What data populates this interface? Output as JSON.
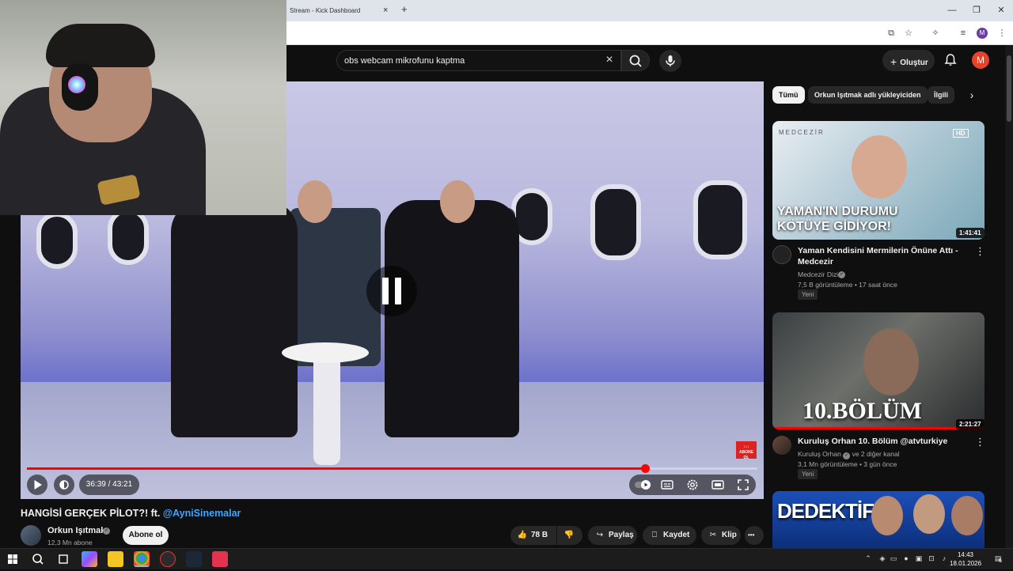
{
  "browser": {
    "tab_title": "Stream - Kick Dashboard",
    "tab_close": "×",
    "new_tab": "+",
    "minimize": "—",
    "restore": "❐",
    "close": "✕",
    "profile_letter": "M"
  },
  "header": {
    "search_value": "obs webcam mikrofunu kaptma",
    "clear_glyph": "×",
    "create_label": "Oluştur",
    "create_plus": "+",
    "avatar_letter": "M"
  },
  "player": {
    "time_display": "36:39 / 43:21",
    "progress_fraction": 0.846,
    "subscribe_overlay": "↓↓↓ ABONE OL"
  },
  "video": {
    "title_main": "HANGİSİ GERÇEK PİLOT?! ft. ",
    "title_mention": "@AyniSinemalar",
    "channel_name": "Orkun Işıtmak",
    "subscribers": "12,3 Mn abone",
    "subscribe_label": "Abone ol",
    "likes": "78 B",
    "share_label": "Paylaş",
    "save_label": "Kaydet",
    "clip_label": "Klip",
    "more_glyph": "•••"
  },
  "sidebar": {
    "chips": [
      "Tümü",
      "Orkun Işıtmak adlı yükleyiciden",
      "İlgili"
    ],
    "chip_next": "›",
    "videos": [
      {
        "title": "Yaman Kendisini Mermilerin Önüne Attı - Medcezir",
        "channel": "Medcezir Dizi",
        "views_age": "7,5 B görüntüleme • 17 saat önce",
        "badge": "Yeni",
        "duration": "1:41:41",
        "thumb_text": "YAMAN'IN DURUMU KÖTÜYE GİDİYOR!",
        "thumb_brand": "MEDCEZİR",
        "thumb_hd": "HD"
      },
      {
        "title": "Kuruluş Orhan 10. Bölüm @atvturkiye",
        "channel": "Kuruluş Orhan",
        "channel_extra": "ve 2 diğer kanal",
        "views_age": "3,1 Mn görüntüleme • 3 gün önce",
        "badge": "Yeni",
        "duration": "2:21:27",
        "thumb_text": "10.BÖLÜM"
      },
      {
        "thumb_text": "DEDEKTİF"
      }
    ],
    "more_glyph": "⋮"
  },
  "taskbar": {
    "time": "14:43",
    "date": "18.01.2026",
    "notification_count": "6"
  },
  "colors": {
    "accent_red": "#ff0000",
    "link_blue": "#3ea6ff",
    "bg": "#0f0f0f"
  }
}
